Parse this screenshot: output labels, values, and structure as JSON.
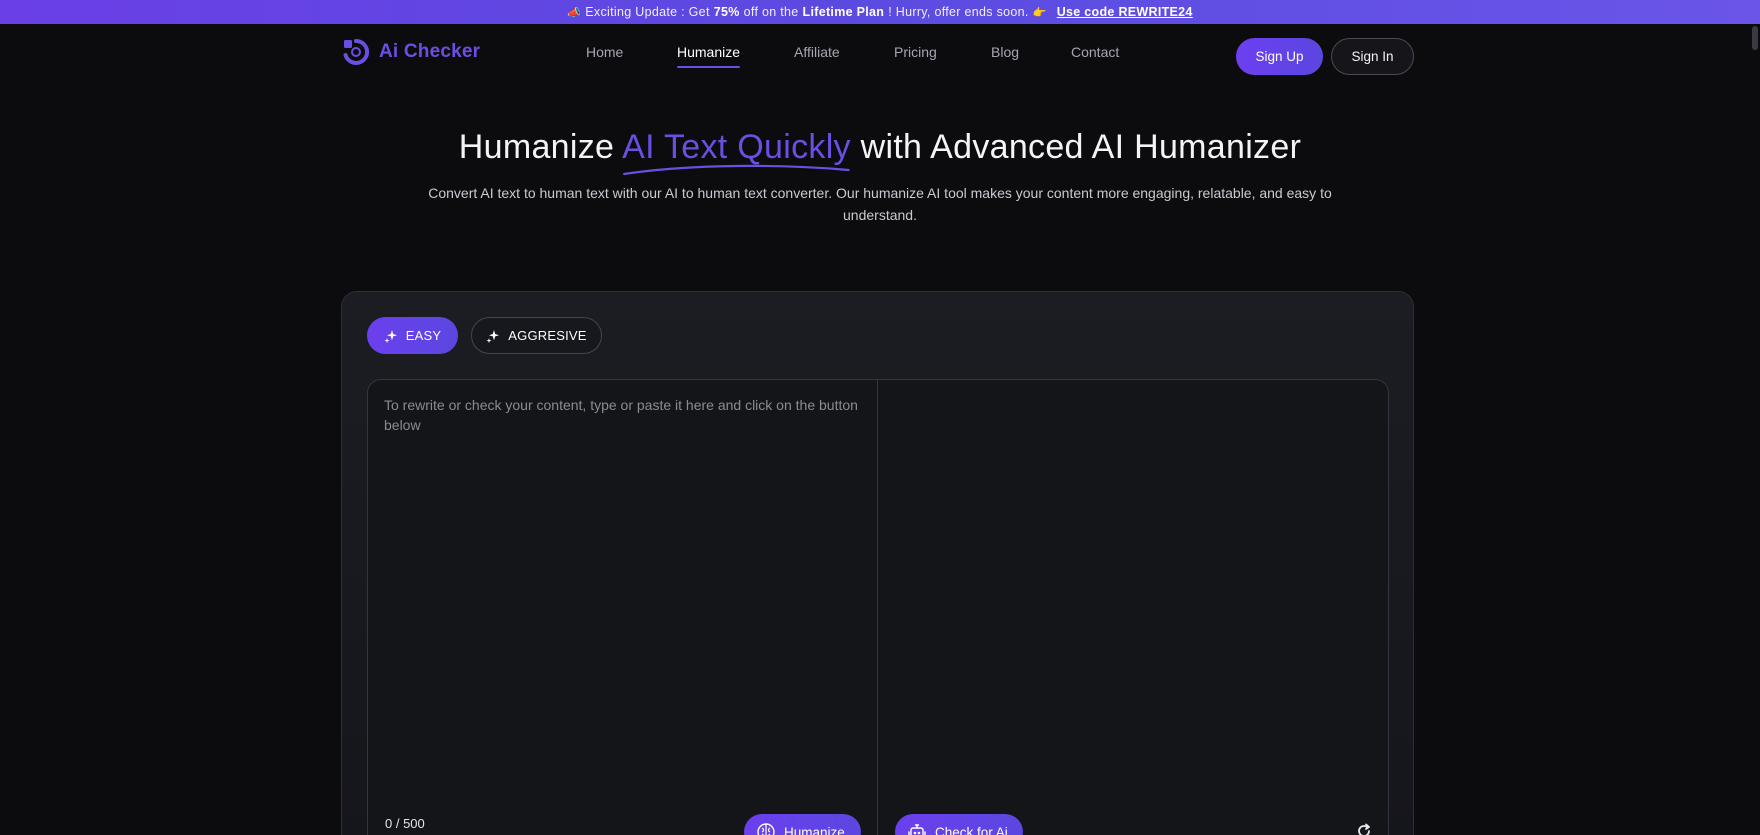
{
  "promo": {
    "icon": "megaphone-icon",
    "lead": "Exciting Update : Get",
    "discount": "75%",
    "middle": "off on the",
    "plan": "Lifetime Plan",
    "tail": "! Hurry, offer ends soon.",
    "tail_icon": "hand-pointing-icon",
    "code_link": "Use code REWRITE24"
  },
  "header": {
    "logo_text": "Ai Checker",
    "nav": [
      {
        "label": "Home",
        "active": false
      },
      {
        "label": "Humanize",
        "active": true
      },
      {
        "label": "Affiliate",
        "active": false
      },
      {
        "label": "Pricing",
        "active": false
      },
      {
        "label": "Blog",
        "active": false
      },
      {
        "label": "Contact",
        "active": false
      }
    ],
    "signup_label": "Sign Up",
    "signin_label": "Sign In"
  },
  "hero": {
    "title_before": "Humanize ",
    "title_accent": "AI Text Quickly",
    "title_after": " with Advanced AI Humanizer",
    "subtitle": "Convert AI text to human text with our AI to human text converter. Our humanize AI tool makes your content more engaging, relatable, and easy to understand."
  },
  "tool": {
    "modes": [
      {
        "label": "EASY",
        "active": true,
        "icon": "sparkle-icon"
      },
      {
        "label": "AGGRESIVE",
        "active": false,
        "icon": "sparkle-icon"
      }
    ],
    "input_placeholder": "To rewrite or check your content, type or paste it here and click on the button below",
    "input_value": "",
    "counter": "0 / 500",
    "humanize_label": "Humanize",
    "humanize_icon": "brain-icon",
    "check_label": "Check for Ai",
    "check_icon": "robot-icon",
    "refresh_icon": "refresh-icon"
  },
  "colors": {
    "accent": "#6a4fe2",
    "background": "#0c0c0f",
    "card": "#1b1d23",
    "banner": "#5b4be0"
  }
}
